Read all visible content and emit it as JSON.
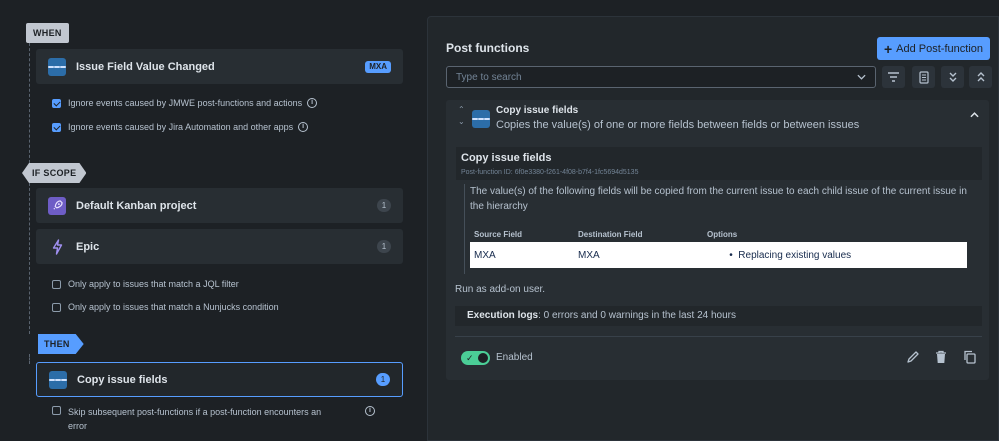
{
  "left": {
    "when_label": "WHEN",
    "trigger": {
      "title": "Issue Field Value Changed",
      "badge": "MXA"
    },
    "trigger_options": [
      {
        "label": "Ignore events caused by JMWE post-functions and actions",
        "checked": true
      },
      {
        "label": "Ignore events caused by Jira Automation and other apps",
        "checked": true
      }
    ],
    "scope_label": "IF SCOPE",
    "scope_items": [
      {
        "title": "Default Kanban project",
        "count": "1"
      },
      {
        "title": "Epic",
        "count": "1"
      }
    ],
    "scope_options": [
      {
        "label": "Only apply to issues that match a JQL filter",
        "checked": false
      },
      {
        "label": "Only apply to issues that match a Nunjucks condition",
        "checked": false
      }
    ],
    "then_label": "THEN",
    "action": {
      "title": "Copy issue fields",
      "count": "1"
    },
    "action_option": {
      "label_line1": "Skip subsequent post-functions if a post-function encounters an",
      "label_line2": "error",
      "checked": false
    }
  },
  "right": {
    "title": "Post functions",
    "add_button": "Add Post-function",
    "search_placeholder": "Type to search",
    "postfunction": {
      "name": "Copy issue fields",
      "description": "Copies the value(s) of one or more fields between fields or between issues",
      "inner_title": "Copy issue fields",
      "id_line": "Post-function ID: 6f0e3380-f261-4f08-b7f4-1fc5694d5135",
      "summary": "The value(s) of the following fields will be copied from the current issue to each child issue of the current issue in the hierarchy",
      "table": {
        "headers": [
          "Source Field",
          "Destination Field",
          "Options"
        ],
        "rows": [
          {
            "source": "MXA",
            "destination": "MXA",
            "option": "Replacing existing values"
          }
        ]
      },
      "run_as": "Run as add-on user.",
      "exec_label": "Execution logs",
      "exec_text": ": 0 errors and 0 warnings in the last 24 hours",
      "enabled_label": "Enabled"
    }
  },
  "colors": {
    "accent": "#579dff",
    "toggle_on": "#4bce97",
    "background": "#1d2125",
    "panel": "#22272b"
  },
  "icons": [
    "lines-icon",
    "rocket-icon",
    "lightning-icon",
    "info-icon",
    "filter-icon",
    "document-icon",
    "collapse-all-icon",
    "expand-all-icon",
    "edit-icon",
    "trash-icon",
    "copy-icon"
  ]
}
